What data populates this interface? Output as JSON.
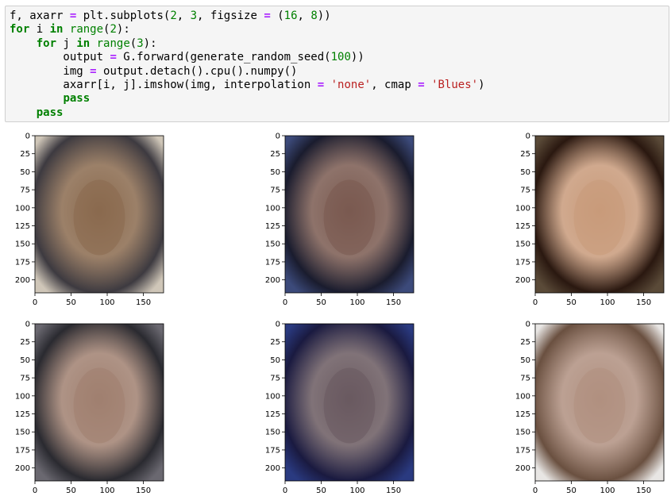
{
  "notebook": {
    "code_lines": [
      "f, axarr = plt.subplots(2, 3, figsize = (16, 8))",
      "for i in range(2):",
      "    for j in range(3):",
      "        output = G.forward(generate_random_seed(100))",
      "        img = output.detach().cpu().numpy()",
      "        axarr[i, j].imshow(img, interpolation = 'none', cmap = 'Blues')",
      "        pass",
      "    pass"
    ]
  },
  "chart_data": {
    "type": "image-grid",
    "rows": 2,
    "cols": 3,
    "xlim": [
      0,
      178
    ],
    "ylim": [
      218,
      0
    ],
    "x_ticks": [
      "0",
      "50",
      "100",
      "150"
    ],
    "y_ticks": [
      "0",
      "25",
      "50",
      "75",
      "100",
      "125",
      "150",
      "175",
      "200"
    ],
    "panels": [
      {
        "row": 0,
        "col": 0,
        "content": "generated face image"
      },
      {
        "row": 0,
        "col": 1,
        "content": "generated face image"
      },
      {
        "row": 0,
        "col": 2,
        "content": "generated face image"
      },
      {
        "row": 1,
        "col": 0,
        "content": "generated face image"
      },
      {
        "row": 1,
        "col": 1,
        "content": "generated face image"
      },
      {
        "row": 1,
        "col": 2,
        "content": "generated face image"
      }
    ]
  },
  "colors": {
    "cell_background": "#f5f5f5",
    "keyword": "#008000",
    "operator": "#aa22ff",
    "string": "#ba2121"
  }
}
